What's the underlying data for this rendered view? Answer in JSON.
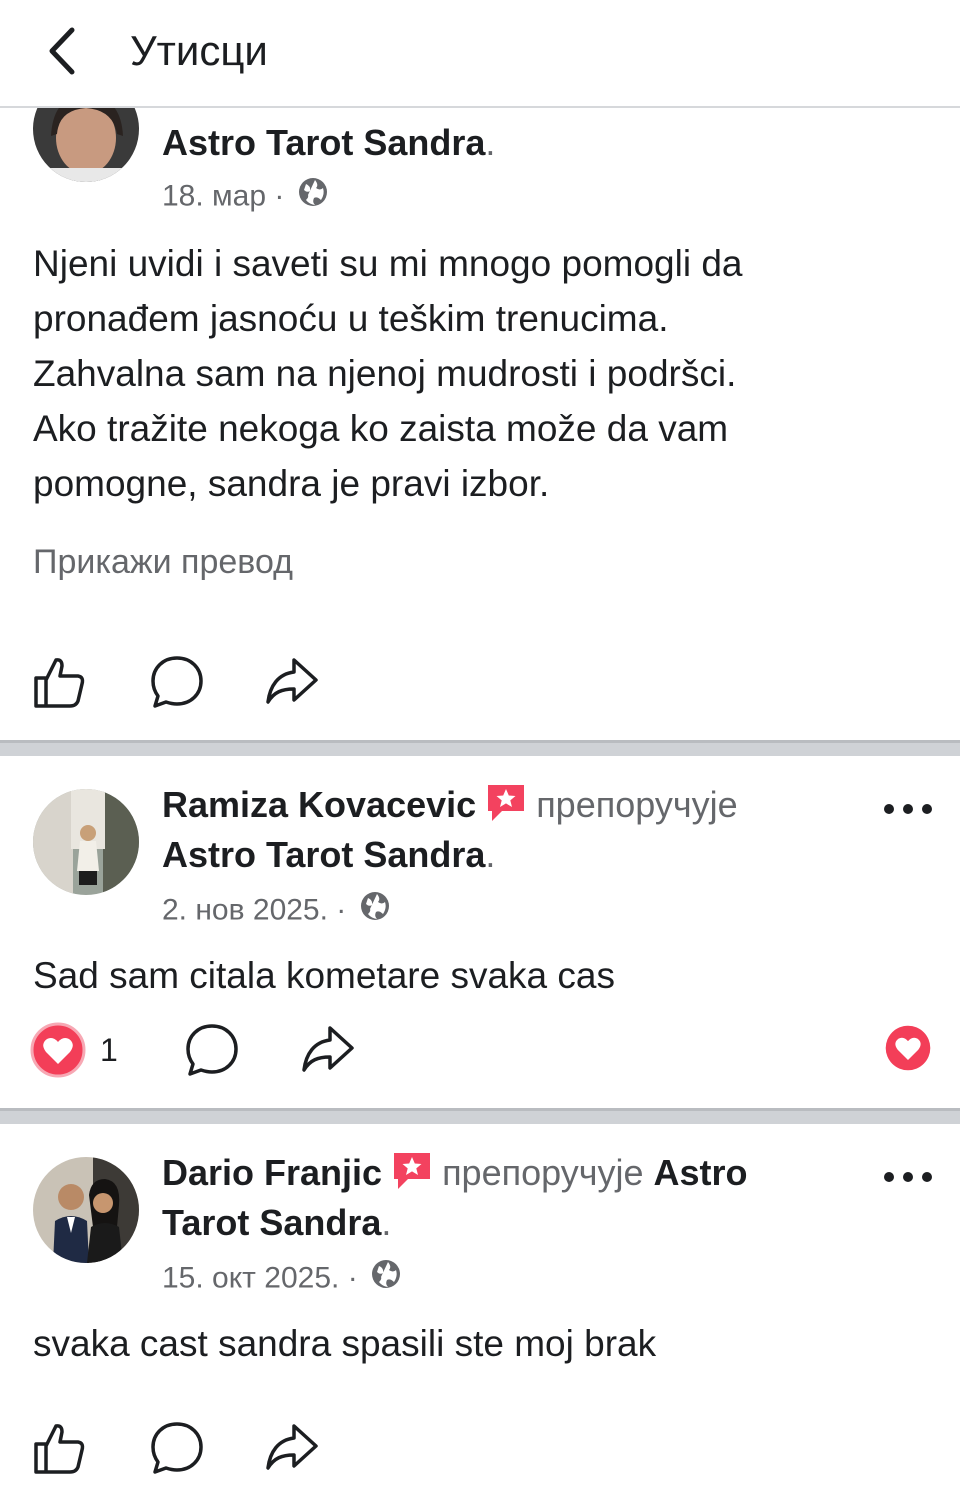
{
  "header": {
    "title": "Утисци"
  },
  "posts": [
    {
      "page_name": "Astro Tarot Sandra",
      "period": ".",
      "date": "18. мар",
      "dot": "·",
      "text_lines": [
        "Njeni uvidi i saveti su mi mnogo pomogli da",
        "pronađem jasnoću u teškim trenucima.",
        "Zahvalna sam na njenoj mudrosti i podršci.",
        "Ako tražite nekoga ko zaista može da vam",
        "pomogne, sandra je pravi izbor."
      ],
      "translate_label": "Прикажи превод"
    },
    {
      "author": "Ramiza Kovacevic",
      "recommends": "препоручује",
      "page_name": "Astro Tarot Sandra",
      "period": ".",
      "date": "2. нов 2025.",
      "dot": "·",
      "text": "Sad sam citala kometare svaka cas",
      "reaction_count": "1"
    },
    {
      "author": "Dario Franjic",
      "recommends": "препоручује",
      "page_name_first": "Astro",
      "page_name_second": "Tarot Sandra",
      "period": ".",
      "date": "15. окт 2025.",
      "dot": "·",
      "text": "svaka cast sandra spasili ste moj brak"
    }
  ],
  "colors": {
    "love": "#f33e58",
    "badge": "#f3425f",
    "muted": "#65676b"
  },
  "icons": [
    "chevron-left-icon",
    "globe-icon",
    "like-icon",
    "comment-icon",
    "share-icon",
    "heart-icon",
    "recommend-badge-icon",
    "more-icon"
  ]
}
